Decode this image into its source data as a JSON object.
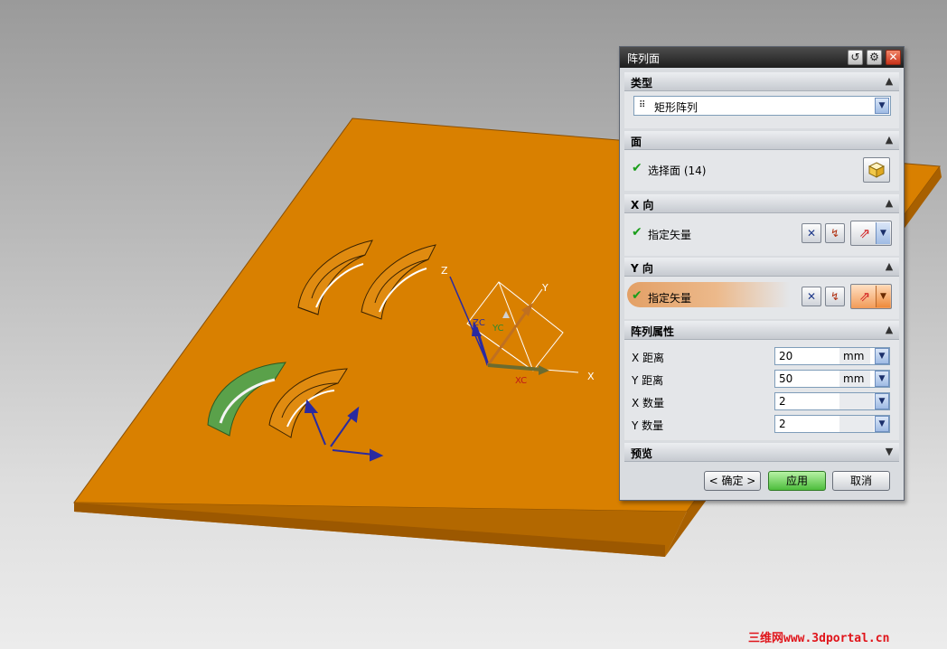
{
  "dialog": {
    "title": "阵列面",
    "titlebar_icons": [
      "reset-icon",
      "gear-icon",
      "close-icon"
    ],
    "sections": {
      "type": {
        "label": "类型",
        "combo_value": "矩形阵列",
        "combo_icon": "rect-array-icon"
      },
      "face": {
        "label": "面",
        "select_label": "选择面 (14)"
      },
      "x_dir": {
        "label": "X 向",
        "vector_label": "指定矢量"
      },
      "y_dir": {
        "label": "Y 向",
        "vector_label": "指定矢量"
      },
      "props": {
        "label": "阵列属性",
        "rows": [
          {
            "label": "X 距离",
            "value": "20",
            "unit": "mm"
          },
          {
            "label": "Y 距离",
            "value": "50",
            "unit": "mm"
          },
          {
            "label": "X 数量",
            "value": "2",
            "unit": ""
          },
          {
            "label": "Y 数量",
            "value": "2",
            "unit": ""
          }
        ]
      },
      "preview": {
        "label": "预览"
      }
    },
    "buttons": {
      "ok": "< 确定 >",
      "apply": "应用",
      "cancel": "取消"
    }
  },
  "viewport": {
    "axis_labels": {
      "z": "Z",
      "y": "Y",
      "x": "X",
      "zc": "ZC",
      "yc": "YC",
      "xc": "XC"
    },
    "colors": {
      "plate": "#d98000",
      "plate_side": "#a85f00",
      "selected_face": "#5aa14a",
      "axis_blue": "#2a2aa0"
    }
  },
  "watermark": "三维网www.3dportal.cn"
}
